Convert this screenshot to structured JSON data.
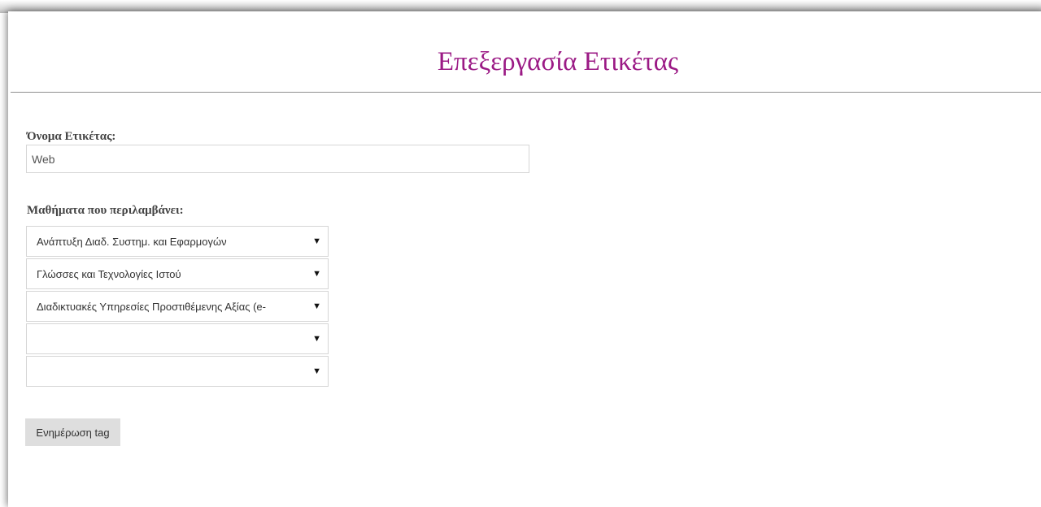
{
  "page": {
    "title": "Επεξεργασία Ετικέτας",
    "title_color": "#9b1a85"
  },
  "form": {
    "name_label": "Όνομα Ετικέτας:",
    "name_value": "Web",
    "courses_label": "Μαθήματα που περιλαμβάνει:",
    "course_selects": [
      {
        "selected": "Ανάπτυξη Διαδ. Συστημ. και Εφαρμογών"
      },
      {
        "selected": "Γλώσσες και Τεχνολογίες Ιστού"
      },
      {
        "selected": "Διαδικτυακές Υπηρεσίες Προστιθέμενης Αξίας (e-"
      },
      {
        "selected": ""
      },
      {
        "selected": ""
      }
    ],
    "dropdown_icon": "triangle-down-icon",
    "submit_label": "Ενημέρωση tag"
  }
}
